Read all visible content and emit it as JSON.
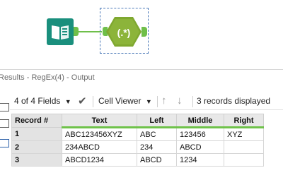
{
  "results": {
    "title": "Results - RegEx(4) - Output"
  },
  "toolbar": {
    "fields_label": "4 of 4 Fields",
    "viewer_label": "Cell Viewer",
    "records_label": "3 records displayed"
  },
  "table": {
    "headers": [
      "Record #",
      "Text",
      "Left",
      "Middle",
      "Right"
    ],
    "rows": [
      [
        "1",
        "ABC123456XYZ",
        "ABC",
        "123456",
        "XYZ"
      ],
      [
        "2",
        "234ABCD",
        "234",
        "ABCD",
        ""
      ],
      [
        "3",
        "ABCD1234",
        "ABCD",
        "1234",
        ""
      ]
    ]
  },
  "workflow": {
    "regex_symbol": "(.*)"
  },
  "icons": {
    "input_tool": "book-icon",
    "regex_tool": "regex-hexagon-icon",
    "check": "check-icon",
    "arrow_up": "arrow-up-icon",
    "arrow_down": "arrow-down-icon"
  },
  "colors": {
    "accent_green": "#6fbf4a",
    "input_tool": "#1a8f7d",
    "regex_tool": "#7fa830"
  }
}
